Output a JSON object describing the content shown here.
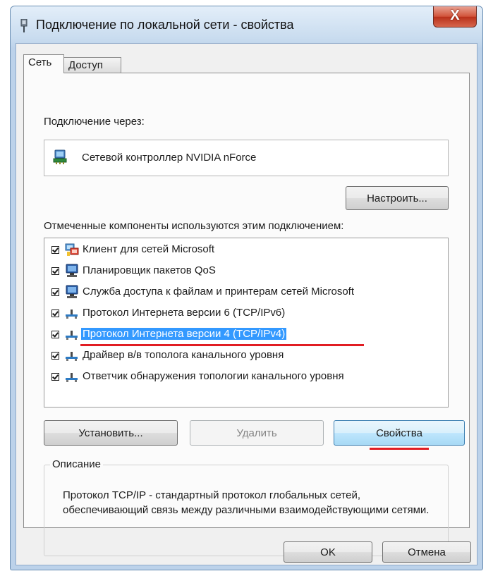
{
  "window": {
    "title": "Подключение по локальной сети - свойства",
    "close_label": "X"
  },
  "tabs": [
    {
      "label": "Сеть",
      "active": true
    },
    {
      "label": "Доступ",
      "active": false
    }
  ],
  "connection": {
    "via_label": "Подключение через:",
    "adapter_name": "Сетевой контроллер NVIDIA nForce",
    "configure_button": "Настроить..."
  },
  "components": {
    "label": "Отмеченные компоненты используются этим подключением:",
    "items": [
      {
        "label": "Клиент для сетей Microsoft",
        "checked": true,
        "icon": "network-client-icon",
        "selected": false
      },
      {
        "label": "Планировщик пакетов QoS",
        "checked": true,
        "icon": "computer-service-icon",
        "selected": false
      },
      {
        "label": "Служба доступа к файлам и принтерам сетей Microsoft",
        "checked": true,
        "icon": "computer-service-icon",
        "selected": false
      },
      {
        "label": "Протокол Интернета версии 6 (TCP/IPv6)",
        "checked": true,
        "icon": "protocol-icon",
        "selected": false
      },
      {
        "label": "Протокол Интернета версии 4 (TCP/IPv4)",
        "checked": true,
        "icon": "protocol-icon",
        "selected": true
      },
      {
        "label": "Драйвер в/в тополога канального уровня",
        "checked": true,
        "icon": "protocol-icon",
        "selected": false
      },
      {
        "label": "Ответчик обнаружения топологии канального уровня",
        "checked": true,
        "icon": "protocol-icon",
        "selected": false
      }
    ]
  },
  "actions": {
    "install_button": "Установить...",
    "uninstall_button": "Удалить",
    "properties_button": "Свойства"
  },
  "description": {
    "legend": "Описание",
    "text": "Протокол TCP/IP - стандартный протокол глобальных сетей, обеспечивающий связь между различными взаимодействующими сетями."
  },
  "footer": {
    "ok_button": "OK",
    "cancel_button": "Отмена"
  },
  "colors": {
    "selection": "#3399ff",
    "annotation_underline": "#e11d23",
    "close_button": "#c8452d"
  }
}
